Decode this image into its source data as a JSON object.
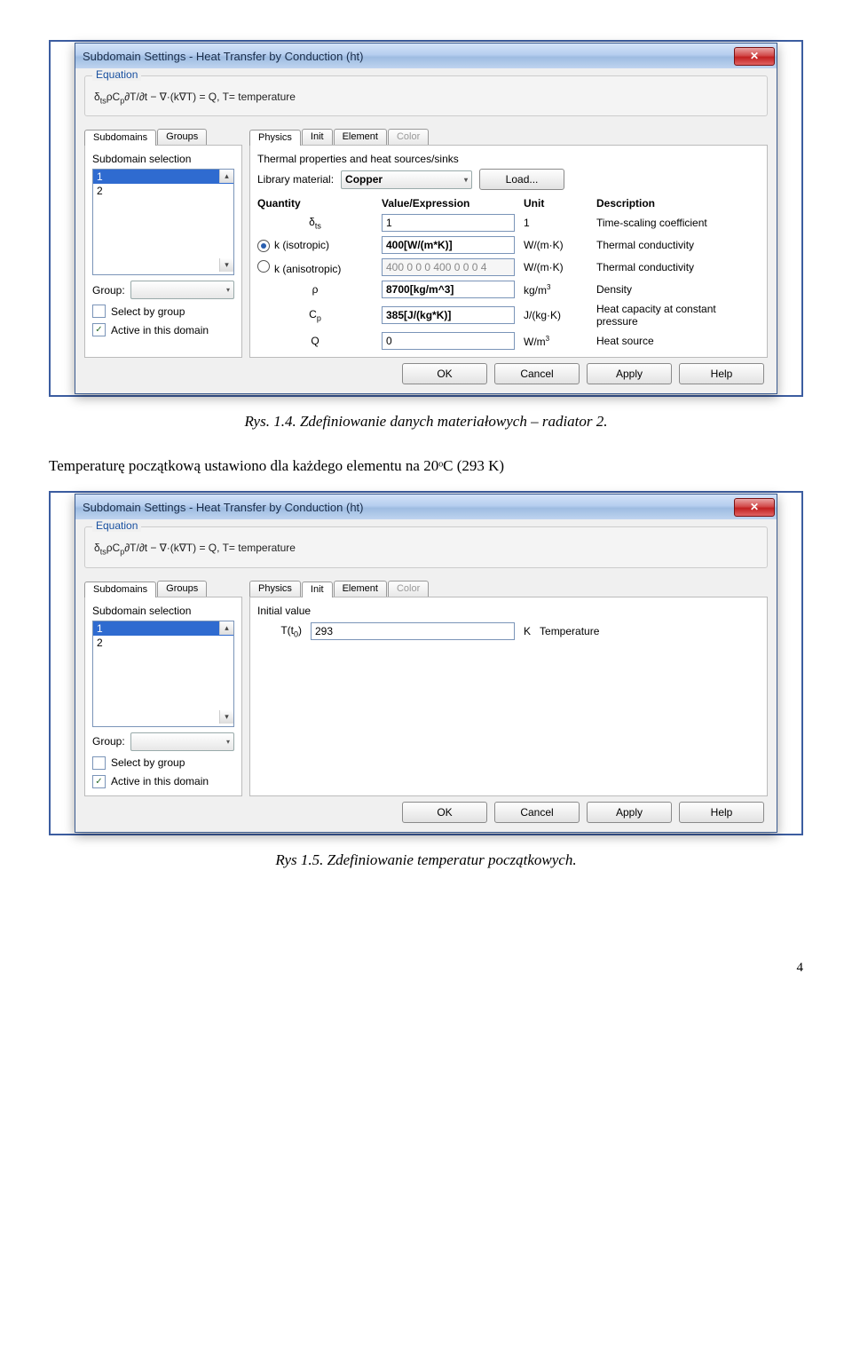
{
  "dialog1": {
    "title": "Subdomain Settings - Heat Transfer by Conduction (ht)",
    "equation_label": "Equation",
    "equation": "δtsρCp∂T/∂t − ∇·(k∇T) = Q, T= temperature",
    "left_tabs": [
      "Subdomains",
      "Groups"
    ],
    "selection_label": "Subdomain selection",
    "items": [
      "1",
      "2"
    ],
    "group_label": "Group:",
    "group_value": "",
    "select_by_group": "Select by group",
    "active_in_domain": "Active in this domain",
    "right_tabs": [
      "Physics",
      "Init",
      "Element",
      "Color"
    ],
    "active_right_tab": 0,
    "section_label": "Thermal properties and heat sources/sinks",
    "libmat_label": "Library material:",
    "libmat_value": "Copper",
    "load_btn": "Load...",
    "col_headers": [
      "Quantity",
      "Value/Expression",
      "Unit",
      "Description"
    ],
    "rows": [
      {
        "q": "δts",
        "v": "1",
        "u": "1",
        "d": "Time-scaling coefficient",
        "bold": false,
        "radio": null,
        "dis": false
      },
      {
        "q": "k (isotropic)",
        "v": "400[W/(m*K)]",
        "u": "W/(m·K)",
        "d": "Thermal conductivity",
        "bold": true,
        "radio": "on",
        "dis": false
      },
      {
        "q": "k (anisotropic)",
        "v": "400 0 0 0 400 0 0 0 4",
        "u": "W/(m·K)",
        "d": "Thermal conductivity",
        "bold": false,
        "radio": "off",
        "dis": true
      },
      {
        "q": "ρ",
        "v": "8700[kg/m^3]",
        "u": "kg/m³",
        "d": "Density",
        "bold": true,
        "radio": null,
        "dis": false
      },
      {
        "q": "Cp",
        "v": "385[J/(kg*K)]",
        "u": "J/(kg·K)",
        "d": "Heat capacity at constant pressure",
        "bold": true,
        "radio": null,
        "dis": false
      },
      {
        "q": "Q",
        "v": "0",
        "u": "W/m³",
        "d": "Heat source",
        "bold": false,
        "radio": null,
        "dis": false
      }
    ]
  },
  "captions": {
    "c1": "Rys. 1.4. Zdefiniowanie danych materiałowych – radiator 2.",
    "body": "Temperaturę początkową ustawiono dla każdego elementu na 20ᵒC (293 K)",
    "c2": "Rys 1.5. Zdefiniowanie temperatur początkowych."
  },
  "dialog2": {
    "title": "Subdomain Settings - Heat Transfer by Conduction (ht)",
    "equation_label": "Equation",
    "equation": "δtsρCp∂T/∂t − ∇·(k∇T) = Q, T= temperature",
    "left_tabs": [
      "Subdomains",
      "Groups"
    ],
    "selection_label": "Subdomain selection",
    "items": [
      "1",
      "2"
    ],
    "group_label": "Group:",
    "group_value": "",
    "select_by_group": "Select by group",
    "active_in_domain": "Active in this domain",
    "right_tabs": [
      "Physics",
      "Init",
      "Element",
      "Color"
    ],
    "active_right_tab": 1,
    "section_label": "Initial value",
    "init_q": "T(t₀)",
    "init_v": "293",
    "init_u": "K",
    "init_d": "Temperature"
  },
  "buttons": {
    "ok": "OK",
    "cancel": "Cancel",
    "apply": "Apply",
    "help": "Help"
  },
  "pagenum": "4"
}
